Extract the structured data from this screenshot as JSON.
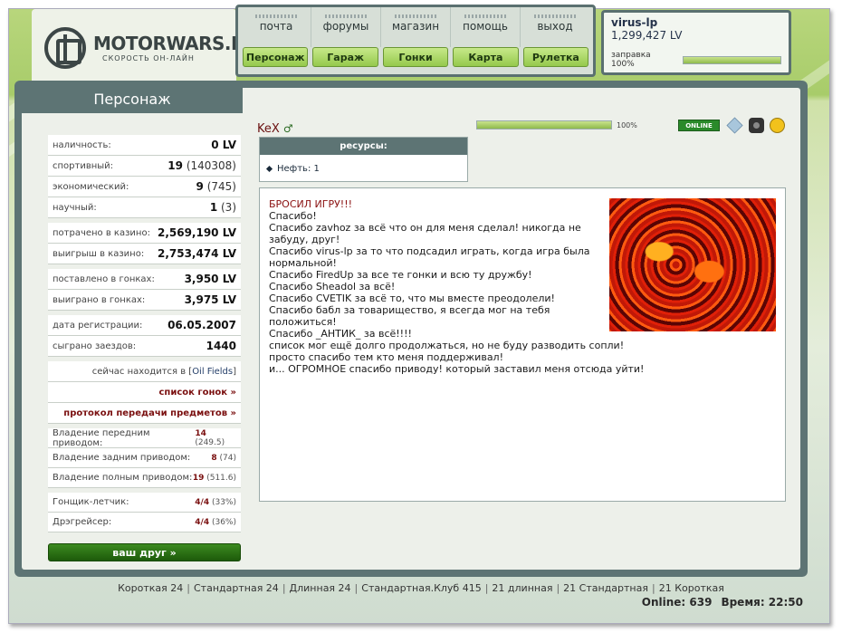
{
  "logo": {
    "title": "MOTORWARS.RU",
    "subtitle": "СКОРОСТЬ ОН-ЛАЙН"
  },
  "nav": {
    "top_links": [
      "почта",
      "форумы",
      "магазин",
      "помощь",
      "выход"
    ],
    "buttons": [
      "Персонаж",
      "Гараж",
      "Гонки",
      "Карта",
      "Рулетка"
    ]
  },
  "user": {
    "name": "virus-lp",
    "money": "1,299,427 LV",
    "fuel_label": "заправка 100%",
    "fuel_percent": 100
  },
  "sidebar": {
    "title": "Персонаж",
    "money": [
      {
        "label": "наличность:",
        "value": "0 LV",
        "sub": ""
      },
      {
        "label": "спортивный:",
        "value": "19",
        "sub": " (140308)"
      },
      {
        "label": "экономический:",
        "value": "9",
        "sub": " (745)"
      },
      {
        "label": "научный:",
        "value": "1",
        "sub": " (3)"
      }
    ],
    "casino": [
      {
        "label": "потрачено в казино:",
        "value": "2,569,190 LV"
      },
      {
        "label": "выигрыш в казино:",
        "value": "2,753,474 LV"
      }
    ],
    "races": [
      {
        "label": "поставлено в гонках:",
        "value": "3,950 LV"
      },
      {
        "label": "выиграно в гонках:",
        "value": "3,975 LV"
      }
    ],
    "registration": [
      {
        "label": "дата регистрации:",
        "value": "06.05.2007"
      },
      {
        "label": "сыграно заездов:",
        "value": "1440"
      }
    ],
    "location": {
      "prefix": "сейчас находится в [",
      "place": "Oil Fields",
      "suffix": "]"
    },
    "links": [
      "список гонок »",
      "протокол передачи предметов »"
    ],
    "drive": [
      {
        "label": "Владение передним приводом:",
        "value": "14",
        "sub": " (249.5)"
      },
      {
        "label": "Владение задним приводом:",
        "value": "8",
        "sub": " (74)"
      },
      {
        "label": "Владение полным приводом:",
        "value": "19",
        "sub": " (511.6)"
      }
    ],
    "titles": [
      {
        "label": "Гонщик-летчик:",
        "value": "4/4",
        "sub": " (33%)"
      },
      {
        "label": "Дрэгрейсер:",
        "value": "4/4",
        "sub": " (36%)"
      }
    ],
    "friend_button": "ваш друг »"
  },
  "character": {
    "name": "KeX",
    "gender_symbol": "♂",
    "progress_percent": 100,
    "progress_label": "100%",
    "status_badge": "ONLINE"
  },
  "resources": {
    "title": "ресурсы:",
    "items": [
      "Нефть: 1"
    ]
  },
  "message": {
    "title": "БРОСИЛ ИГРУ!!!",
    "paragraphs": [
      "Спасибо!",
      "Спасибо zavhoz за всё что он для меня сделал! никогда не забуду, друг!",
      "Спасибо virus-lp за то что подсадил играть, когда игра была нормальной!",
      "Спасибо FiredUp за все те гонки и всю ту дружбу!",
      "Спасибо Sheadol за всё!",
      "Спасибо CVETIK за всё то, что мы вместе преодолели!",
      "Спасибо бабл за товарищество, я всегда мог на тебя положиться!",
      "Спасибо _АНТИК_ за всё!!!!"
    ],
    "closing": [
      "список мог ещё долго продолжаться, но не буду разводить сопли!",
      "просто спасибо тем кто меня поддерживал!",
      "и... ОГРОМНОЕ спасибо приводу! который заставил меня отсюда уйти!"
    ]
  },
  "footer": {
    "links": [
      "Короткая 24",
      "Стандартная 24",
      "Длинная 24",
      "Стандартная.Клуб 415",
      "21 длинная",
      "21 Стандартная",
      "21 Короткая"
    ],
    "online_label": "Online: 639",
    "time_label": "Время: 22:50"
  },
  "colors": {
    "accent_green": "#95c94c",
    "header_teal": "#5d7474",
    "title_red": "#8a1010"
  }
}
